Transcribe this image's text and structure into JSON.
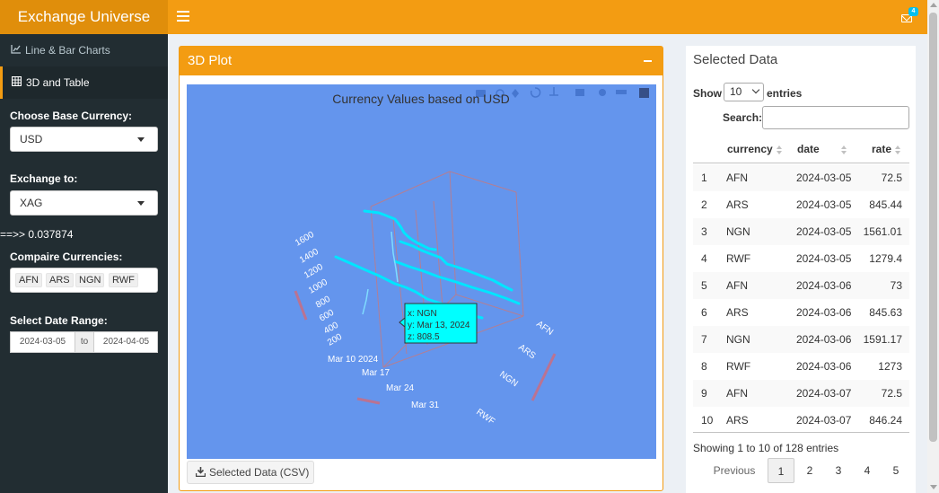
{
  "app": {
    "title": "Exchange Universe",
    "notification_count": "4"
  },
  "sidebar": {
    "menu": [
      {
        "label": "Line & Bar Charts",
        "icon": "line-chart-icon"
      },
      {
        "label": "3D and Table",
        "icon": "table-icon"
      }
    ],
    "base_currency_label": "Choose Base Currency:",
    "base_currency_value": "USD",
    "exchange_to_label": "Exchange to:",
    "exchange_to_value": "XAG",
    "exchange_result": "==>> 0.037874",
    "compare_label": "Compaire Currencies:",
    "compare_values": [
      "AFN",
      "ARS",
      "NGN",
      "RWF"
    ],
    "date_range_label": "Select Date Range:",
    "date_start": "2024-03-05",
    "date_sep": "to",
    "date_end": "2024-04-05"
  },
  "plot_box": {
    "title": "3D Plot",
    "download_label": "Selected Data (CSV)"
  },
  "plot": {
    "title": "Currency Values based on USD",
    "background": "#6495ed",
    "z_ticks": [
      "1600",
      "1400",
      "1200",
      "1000",
      "800",
      "600",
      "400",
      "200"
    ],
    "y_ticks": [
      "Mar 10 2024",
      "Mar 17",
      "Mar 24",
      "Mar 31"
    ],
    "x_ticks": [
      "AFN",
      "ARS",
      "NGN",
      "RWF"
    ],
    "tooltip": {
      "x": "x: NGN",
      "y": "y: Mar 13, 2024",
      "z": "z: 808.5"
    }
  },
  "chart_data": {
    "type": "scatter",
    "title": "Currency Values based on USD",
    "x": [
      "AFN",
      "ARS",
      "NGN",
      "RWF"
    ],
    "y_range": [
      "2024-03-05",
      "2024-04-05"
    ],
    "zlim": [
      200,
      1600
    ],
    "hover_point": {
      "x": "NGN",
      "y": "2024-03-13",
      "z": 808.5
    }
  },
  "data_panel": {
    "title": "Selected Data",
    "show_label": "Show",
    "page_length": "10",
    "entries_label": "entries",
    "search_label": "Search:",
    "columns": [
      "currency",
      "date",
      "rate"
    ],
    "rows": [
      [
        "1",
        "AFN",
        "2024-03-05",
        "72.5"
      ],
      [
        "2",
        "ARS",
        "2024-03-05",
        "845.44"
      ],
      [
        "3",
        "NGN",
        "2024-03-05",
        "1561.01"
      ],
      [
        "4",
        "RWF",
        "2024-03-05",
        "1279.4"
      ],
      [
        "5",
        "AFN",
        "2024-03-06",
        "73"
      ],
      [
        "6",
        "ARS",
        "2024-03-06",
        "845.63"
      ],
      [
        "7",
        "NGN",
        "2024-03-06",
        "1591.17"
      ],
      [
        "8",
        "RWF",
        "2024-03-06",
        "1273"
      ],
      [
        "9",
        "AFN",
        "2024-03-07",
        "72.5"
      ],
      [
        "10",
        "ARS",
        "2024-03-07",
        "846.24"
      ]
    ],
    "info": "Showing 1 to 10 of 128 entries",
    "pagination": {
      "previous": "Previous",
      "pages": [
        "1",
        "2",
        "3",
        "4",
        "5"
      ],
      "current": "1"
    }
  },
  "colors": {
    "header": "#f39c12",
    "logo": "#e08e0b",
    "sidebar": "#222d32",
    "plot_bg": "#6495ed",
    "series": "#00e5ff",
    "tooltip": "#00ffff"
  }
}
